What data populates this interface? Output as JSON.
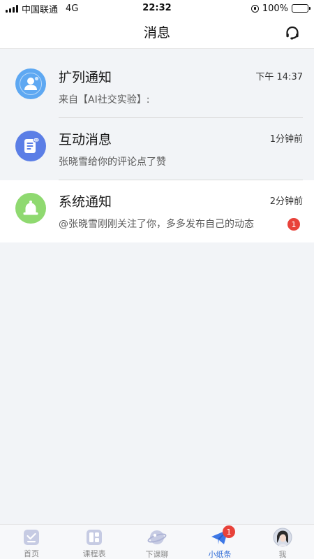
{
  "status_bar": {
    "carrier": "中国联通",
    "network": "4G",
    "time": "22:32",
    "battery": "100%"
  },
  "header": {
    "title": "消息",
    "action_icon": "headset-icon"
  },
  "messages": [
    {
      "title": "扩列通知",
      "time": "下午 14:37",
      "preview": "来自【AI社交实验】:",
      "icon": "user-contact-icon",
      "icon_color": "#5ea8f2"
    },
    {
      "title": "互动消息",
      "time": "1分钟前",
      "preview": "张晓雪给你的评论点了赞",
      "icon": "chat-document-icon",
      "icon_color": "#5b7ee6"
    },
    {
      "title": "系统通知",
      "time": "2分钟前",
      "preview": "@张晓雪刚刚关注了你，多多发布自己的动态",
      "icon": "bell-icon",
      "icon_color": "#8fd970",
      "unread": "1"
    }
  ],
  "tabs": [
    {
      "label": "首页",
      "icon": "home-icon"
    },
    {
      "label": "课程表",
      "icon": "timetable-icon"
    },
    {
      "label": "下课聊",
      "icon": "planet-icon"
    },
    {
      "label": "小纸条",
      "icon": "paper-plane-icon",
      "badge": "1",
      "active": true
    },
    {
      "label": "我",
      "icon": "profile-avatar"
    }
  ],
  "colors": {
    "accent": "#2d6ad6",
    "badge": "#e8423a"
  }
}
